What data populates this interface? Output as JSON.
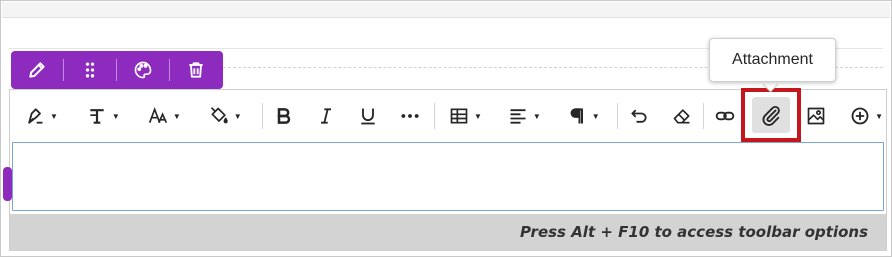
{
  "block_toolbar": {
    "items": [
      {
        "name": "edit",
        "icon": "pencil-icon"
      },
      {
        "name": "move",
        "icon": "drag-dots-icon"
      },
      {
        "name": "style",
        "icon": "palette-icon"
      },
      {
        "name": "delete",
        "icon": "trash-icon"
      }
    ],
    "accent_color": "#8e2bbf"
  },
  "editor_toolbar": {
    "buttons": [
      {
        "name": "text-color",
        "icon": "pen-color-icon",
        "dropdown": true
      },
      {
        "name": "text-style",
        "icon": "text-style-icon",
        "dropdown": true
      },
      {
        "name": "font-size",
        "icon": "font-size-icon",
        "dropdown": true
      },
      {
        "name": "highlight",
        "icon": "paint-bucket-icon",
        "dropdown": true
      },
      {
        "name": "bold",
        "icon": "bold-icon"
      },
      {
        "name": "italic",
        "icon": "italic-icon"
      },
      {
        "name": "underline",
        "icon": "underline-icon"
      },
      {
        "name": "more",
        "icon": "ellipsis-icon"
      },
      {
        "name": "table",
        "icon": "table-icon",
        "dropdown": true
      },
      {
        "name": "align",
        "icon": "align-left-icon",
        "dropdown": true
      },
      {
        "name": "paragraph",
        "icon": "pilcrow-icon",
        "dropdown": true
      },
      {
        "name": "undo",
        "icon": "undo-icon"
      },
      {
        "name": "clear-format",
        "icon": "eraser-icon"
      },
      {
        "name": "link",
        "icon": "link-icon"
      },
      {
        "name": "attachment",
        "icon": "paperclip-icon",
        "highlighted": true
      },
      {
        "name": "image",
        "icon": "image-icon"
      },
      {
        "name": "insert",
        "icon": "plus-circle-icon",
        "dropdown": true
      }
    ],
    "highlight_border_color": "#c5161d"
  },
  "tooltip": {
    "text": "Attachment"
  },
  "status_bar": {
    "text": "Press Alt + F10 to access toolbar options"
  }
}
